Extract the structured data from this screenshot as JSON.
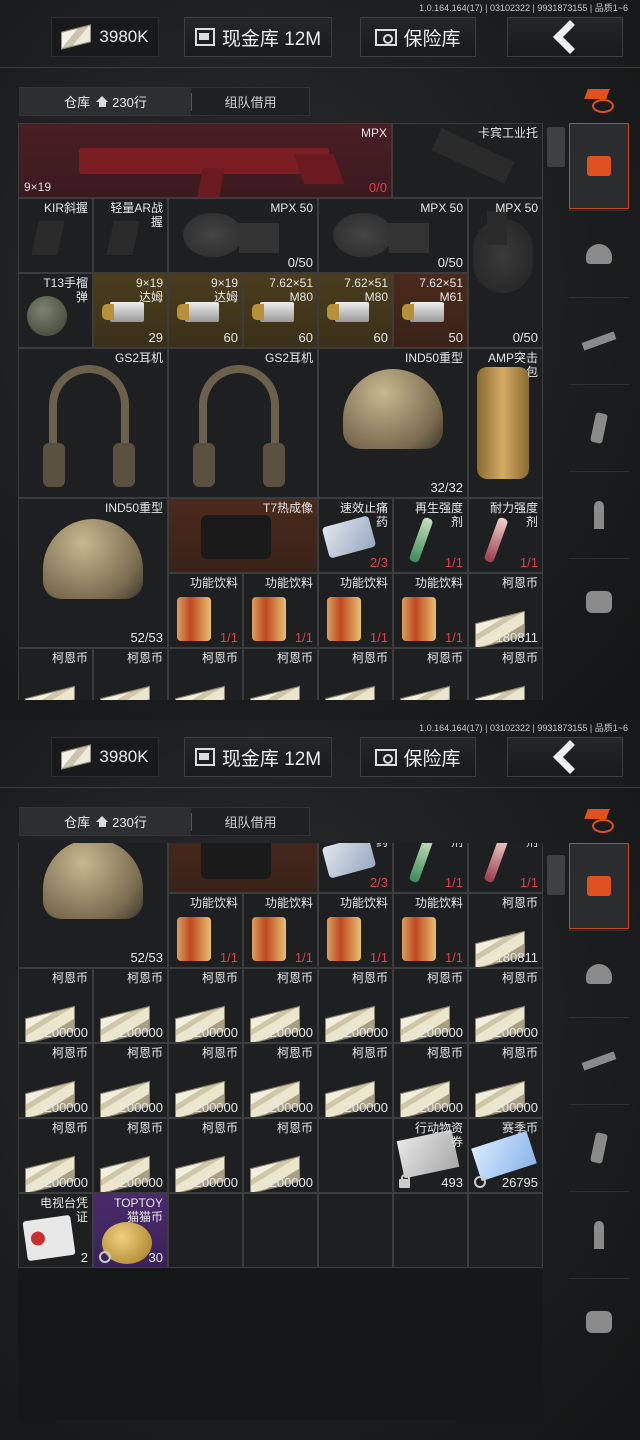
{
  "version": "1.0.164.164(17) | 03102322 | 9931873155 | 品质1~6",
  "topbar": {
    "money": "3980K",
    "cash_label": "现金库 12M",
    "safe_label": "保险库"
  },
  "tabs": {
    "warehouse": "仓库",
    "rows": "230行",
    "team": "组队借用"
  },
  "colors": {
    "accent": "#e05020",
    "red_cell": "#4a1e24",
    "gold_cell": "#4b3d1c"
  },
  "icons": {
    "back": "chevron-left-icon",
    "money": "cash-stack-icon",
    "cash": "cash-vault-icon",
    "safe": "safe-icon"
  },
  "items": [
    {
      "id": "mpx",
      "name": "MPX",
      "caliber": "9×19",
      "count": "0/0",
      "redc": true,
      "bg": "red",
      "img": "gun"
    },
    {
      "id": "stock",
      "name": "卡宾工业托",
      "bg": "",
      "img": "stock"
    },
    {
      "id": "kir",
      "name": "KIR斜握",
      "bg": "",
      "img": "grip"
    },
    {
      "id": "arg",
      "name": "轻量AR战\n握",
      "bg": "",
      "img": "grip"
    },
    {
      "id": "mag1",
      "name": "MPX 50",
      "count": "0/50",
      "countRed0": true,
      "img": "drum"
    },
    {
      "id": "mag2",
      "name": "MPX 50",
      "count": "0/50",
      "countRed0": true,
      "img": "drum"
    },
    {
      "id": "mag3",
      "name": "MPX 50",
      "count": "0/50",
      "countRed0": true,
      "img": "bigmag"
    },
    {
      "id": "t13",
      "name": "T13手榴\n弹",
      "img": "grenade"
    },
    {
      "id": "a1",
      "name": "9×19\n达姆",
      "count": "29",
      "bg": "gold",
      "img": "ammo"
    },
    {
      "id": "a2",
      "name": "9×19\n达姆",
      "count": "60",
      "bg": "gold",
      "img": "ammo"
    },
    {
      "id": "a3",
      "name": "7.62×51\nM80",
      "count": "60",
      "bg": "gold",
      "img": "ammo"
    },
    {
      "id": "a4",
      "name": "7.62×51\nM80",
      "count": "60",
      "bg": "gold",
      "img": "ammo"
    },
    {
      "id": "a5",
      "name": "7.62×51\nM61",
      "count": "50",
      "bg": "brown",
      "img": "ammo"
    },
    {
      "id": "gs1",
      "name": "GS2耳机",
      "img": "headset"
    },
    {
      "id": "gs2",
      "name": "GS2耳机",
      "img": "headset"
    },
    {
      "id": "ind1",
      "name": "IND50重型",
      "count": "32/32",
      "img": "helmet"
    },
    {
      "id": "amp",
      "name": "AMP突击\n包",
      "img": "backpack"
    },
    {
      "id": "ind2",
      "name": "IND50重型",
      "count": "52/53",
      "img": "helmet"
    },
    {
      "id": "t7",
      "name": "T7热成像",
      "bg": "brown",
      "img": "camera"
    },
    {
      "id": "med",
      "name": "速效止痛\n药",
      "count": "2/3",
      "redc": true,
      "img": "pills"
    },
    {
      "id": "regen",
      "name": "再生强度\n剂",
      "count": "1/1",
      "redc": true,
      "img": "tubeg"
    },
    {
      "id": "endu",
      "name": "耐力强度\n剂",
      "count": "1/1",
      "redc": true,
      "img": "tuber"
    },
    {
      "id": "d1",
      "name": "功能饮料",
      "count": "1/1",
      "redc": true,
      "img": "can"
    },
    {
      "id": "d2",
      "name": "功能饮料",
      "count": "1/1",
      "redc": true,
      "img": "can"
    },
    {
      "id": "d3",
      "name": "功能饮料",
      "count": "1/1",
      "redc": true,
      "img": "can"
    },
    {
      "id": "d4",
      "name": "功能饮料",
      "count": "1/1",
      "redc": true,
      "img": "can"
    },
    {
      "id": "k0",
      "name": "柯恩币",
      "count": "180811",
      "img": "bills"
    },
    {
      "id": "k1",
      "name": "柯恩币",
      "count": "200000",
      "img": "bills"
    },
    {
      "id": "k2",
      "name": "柯恩币",
      "count": "200000",
      "img": "bills"
    },
    {
      "id": "k3",
      "name": "柯恩币",
      "count": "200000",
      "img": "bills"
    },
    {
      "id": "k4",
      "name": "柯恩币",
      "count": "200000",
      "img": "bills"
    },
    {
      "id": "k5",
      "name": "柯恩币",
      "count": "200000",
      "img": "bills"
    },
    {
      "id": "k6",
      "name": "柯恩币",
      "count": "200000",
      "img": "bills"
    },
    {
      "id": "k7",
      "name": "柯恩币",
      "count": "200000",
      "img": "bills"
    },
    {
      "id": "k8",
      "name": "柯恩币",
      "count": "200000",
      "img": "bills"
    },
    {
      "id": "k9",
      "name": "柯恩币",
      "count": "200000",
      "img": "bills"
    },
    {
      "id": "k10",
      "name": "柯恩币",
      "count": "200000",
      "img": "bills"
    },
    {
      "id": "k11",
      "name": "柯恩币",
      "count": "200000",
      "img": "bills"
    },
    {
      "id": "k12",
      "name": "柯恩币",
      "count": "200000",
      "img": "bills"
    },
    {
      "id": "k13",
      "name": "柯恩币",
      "count": "200000",
      "img": "bills"
    },
    {
      "id": "k14",
      "name": "柯恩币",
      "count": "200000",
      "img": "bills"
    },
    {
      "id": "k15",
      "name": "柯恩币",
      "count": "200000",
      "img": "bills"
    },
    {
      "id": "k16",
      "name": "柯恩币",
      "count": "200000",
      "img": "bills"
    },
    {
      "id": "k17",
      "name": "柯恩币",
      "count": "200000",
      "img": "bills"
    },
    {
      "id": "k18",
      "name": "柯恩币",
      "count": "200000",
      "img": "bills"
    },
    {
      "id": "act",
      "name": "行动物资\n券",
      "count": "493",
      "img": "ticket",
      "badge": "lock"
    },
    {
      "id": "season",
      "name": "赛季币",
      "count": "26795",
      "img": "pass",
      "badge": "round"
    },
    {
      "id": "tv",
      "name": "电视台凭\n证",
      "count": "2",
      "img": "card"
    },
    {
      "id": "toy",
      "name": "TOPTOY\n猫猫币",
      "count": "30",
      "bg": "purple",
      "img": "coin",
      "badge": "round"
    }
  ],
  "sidebar": {
    "top_icon": "stack-refresh-icon",
    "items": [
      "warehouse-icon",
      "helmet-icon",
      "rifle-icon",
      "magazine-icon",
      "ammo-icon",
      "scope-icon"
    ]
  }
}
